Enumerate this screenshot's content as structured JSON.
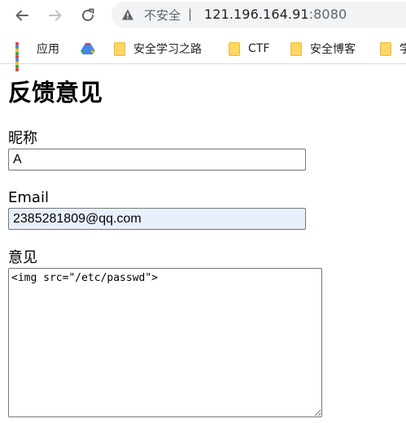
{
  "browser": {
    "insecure_label": "不安全",
    "separator": "|",
    "url_host": "121.196.164.91",
    "url_port": ":8080"
  },
  "bookmarks": [
    {
      "label": "应用",
      "icon": "apps-grid-icon"
    },
    {
      "label": "",
      "icon": "google-drive-icon"
    },
    {
      "label": "安全学习之路",
      "icon": "folder-icon"
    },
    {
      "label": "CTF",
      "icon": "folder-icon"
    },
    {
      "label": "安全博客",
      "icon": "folder-icon"
    },
    {
      "label": "学",
      "icon": "folder-icon"
    }
  ],
  "page": {
    "title": "反馈意见",
    "nickname": {
      "label": "昵称",
      "value": "A"
    },
    "email": {
      "label": "Email",
      "value": "2385281809@qq.com"
    },
    "feedback": {
      "label": "意见",
      "value": "<img src=\"/etc/passwd\">"
    }
  },
  "colors": {
    "autofill_bg": "#e8f0fe",
    "folder": "#fdd663",
    "omnibox_bg": "#f1f3f4"
  }
}
